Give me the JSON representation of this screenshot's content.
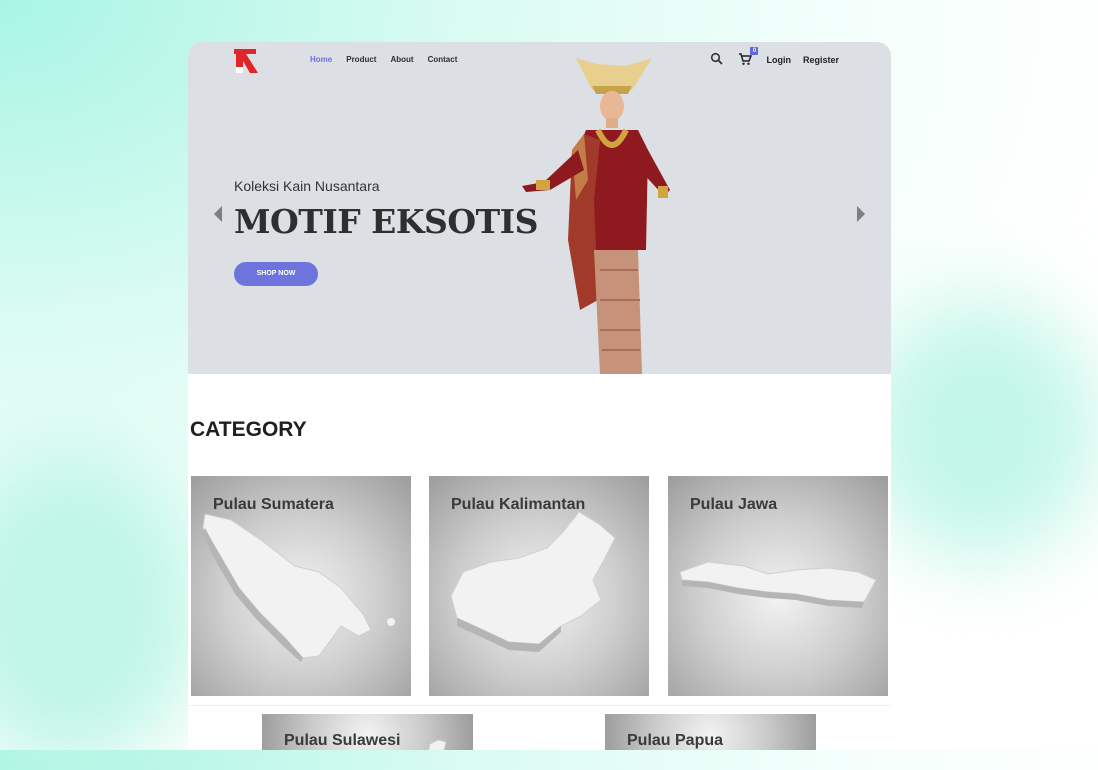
{
  "nav": {
    "items": [
      "Home",
      "Product",
      "About",
      "Contact"
    ],
    "active": "Home"
  },
  "header": {
    "cart_count": "0",
    "login_label": "Login",
    "register_label": "Register",
    "search_icon": "search-icon",
    "cart_icon": "cart-icon"
  },
  "hero": {
    "subtitle": "Koleksi Kain Nusantara",
    "headline": "MOTIF EKSOTIS",
    "cta_label": "SHOP NOW"
  },
  "category": {
    "title": "CATEGORY",
    "items": [
      "Pulau Sumatera",
      "Pulau Kalimantan",
      "Pulau Jawa",
      "Pulau Sulawesi",
      "Pulau Papua"
    ]
  },
  "colors": {
    "accent": "#6d75dd",
    "brand_red": "#e0262b",
    "hero_bg": "#dcdfe4"
  }
}
